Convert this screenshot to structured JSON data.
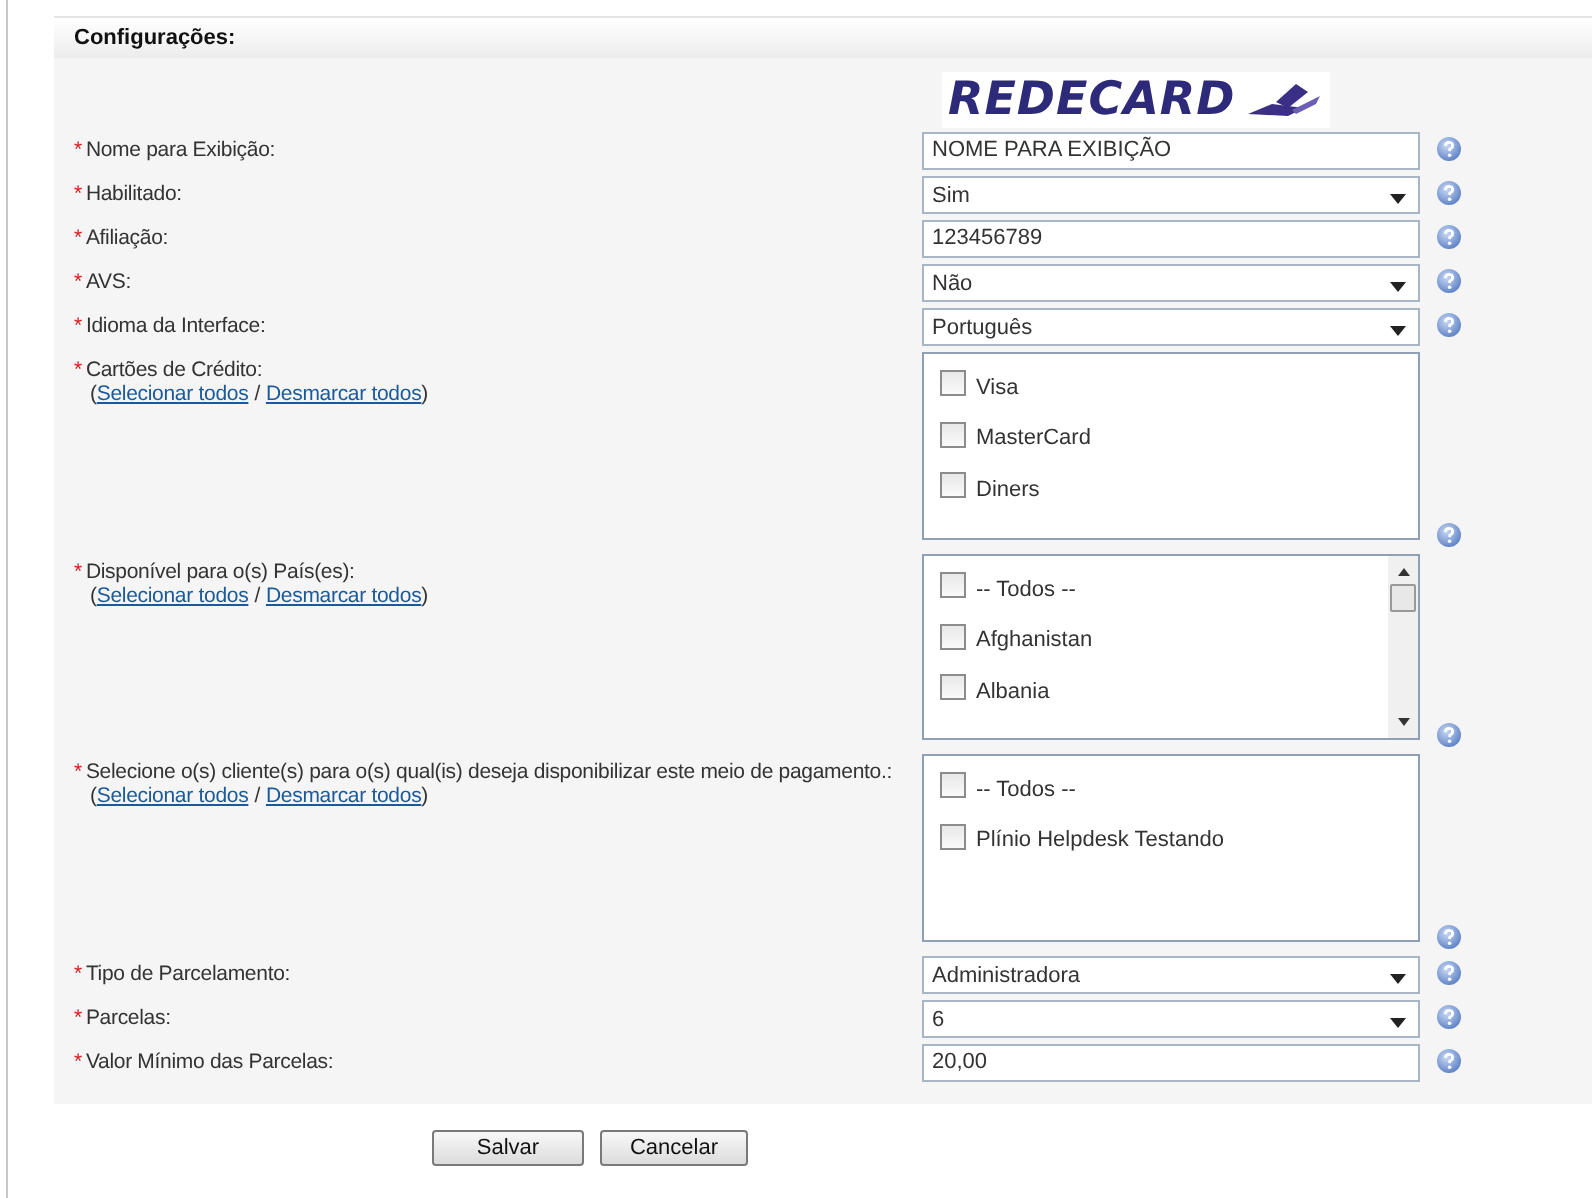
{
  "section": {
    "title": "Configurações:"
  },
  "logo": {
    "text": "REDECARD"
  },
  "fields": [
    {
      "kind": "text",
      "marker": "*",
      "label": "Nome para Exibição:",
      "value": "NOME PARA EXIBIÇÃO"
    },
    {
      "kind": "select",
      "marker": "*",
      "label": "Habilitado:",
      "value": "Sim"
    },
    {
      "kind": "text",
      "marker": "*",
      "label": "Afiliação:",
      "value": "123456789"
    },
    {
      "kind": "select",
      "marker": "*",
      "label": "AVS:",
      "value": "Não"
    },
    {
      "kind": "select",
      "marker": "*",
      "label": "Idioma da Interface:",
      "value": "Português"
    },
    {
      "kind": "checklist",
      "marker": "*",
      "label": "Cartões de Crédito:",
      "links": [
        {
          "kind": "text",
          "text": "("
        },
        {
          "kind": "link",
          "text": "Selecionar todos"
        },
        {
          "kind": "text",
          "text": "/"
        },
        {
          "kind": "link",
          "text": "Desmarcar todos"
        },
        {
          "kind": "text",
          "text": ")"
        }
      ],
      "scrollable": false,
      "options": [
        {
          "label": "Visa",
          "checked": false
        },
        {
          "label": "MasterCard",
          "checked": false
        },
        {
          "label": "Diners",
          "checked": false
        }
      ]
    },
    {
      "kind": "checklist",
      "marker": "*",
      "label": "Disponível para o(s) País(es):",
      "links": [
        {
          "kind": "text",
          "text": "("
        },
        {
          "kind": "link",
          "text": "Selecionar todos"
        },
        {
          "kind": "text",
          "text": "/"
        },
        {
          "kind": "link",
          "text": "Desmarcar todos"
        },
        {
          "kind": "text",
          "text": ")"
        }
      ],
      "scrollable": true,
      "options": [
        {
          "label": "-- Todos --",
          "checked": false
        },
        {
          "label": "Afghanistan",
          "checked": false
        },
        {
          "label": "Albania",
          "checked": false
        }
      ]
    },
    {
      "kind": "checklist",
      "marker": "*",
      "label": "Selecione o(s) cliente(s) para o(s) qual(is) deseja disponibilizar este meio de pagamento.:",
      "links": [
        {
          "kind": "text",
          "text": "("
        },
        {
          "kind": "link",
          "text": "Selecionar todos"
        },
        {
          "kind": "text",
          "text": "/"
        },
        {
          "kind": "link",
          "text": "Desmarcar todos"
        },
        {
          "kind": "text",
          "text": ")"
        }
      ],
      "scrollable": false,
      "options": [
        {
          "label": "-- Todos --",
          "checked": false
        },
        {
          "label": "Plínio Helpdesk Testando",
          "checked": false
        }
      ]
    },
    {
      "kind": "select",
      "marker": "*",
      "label": "Tipo de Parcelamento:",
      "value": "Administradora"
    },
    {
      "kind": "select",
      "marker": "*",
      "label": "Parcelas:",
      "value": "6"
    },
    {
      "kind": "text",
      "marker": "*",
      "label": "Valor Mínimo das Parcelas:",
      "value": "20,00"
    }
  ],
  "buttons": [
    "Salvar",
    "Cancelar"
  ]
}
